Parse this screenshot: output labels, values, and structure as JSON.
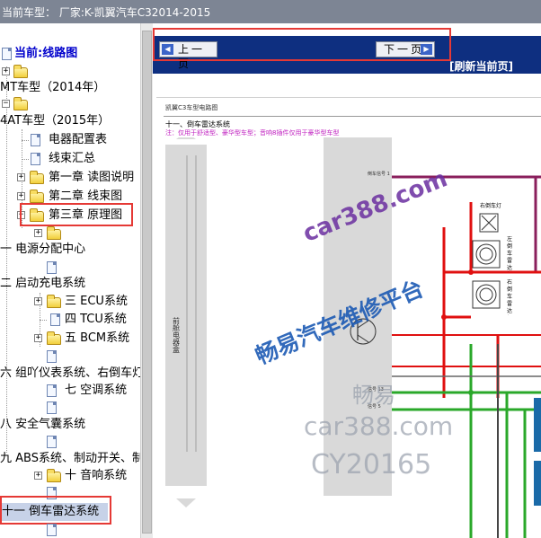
{
  "window": {
    "title": "当前车型：  厂家:K-凯翼汽车C32014-2015"
  },
  "tree": {
    "root": "当前:线路图",
    "items": [
      {
        "label": "MT车型（2014年）"
      },
      {
        "label": "4AT车型（2015年）"
      },
      {
        "label": "电器配置表"
      },
      {
        "label": "线束汇总"
      },
      {
        "label": "第一章 读图说明"
      },
      {
        "label": "第二章 线束图"
      },
      {
        "label": "第三章 原理图"
      },
      {
        "label": "一 电源分配中心"
      },
      {
        "label": "二 启动充电系统"
      },
      {
        "label": "三 ECU系统"
      },
      {
        "label": "四 TCU系统"
      },
      {
        "label": "五 BCM系统"
      },
      {
        "label": "六 组吖仪表系统、右倒车灯"
      },
      {
        "label": "七 空调系统"
      },
      {
        "label": "八 安全气囊系统"
      },
      {
        "label": "九 ABS系统、制动开关、制"
      },
      {
        "label": "十 音响系统"
      },
      {
        "label": "十一 倒车雷达系统"
      }
    ]
  },
  "toolbar": {
    "prev_label": "上一页",
    "next_label": "下一页",
    "refresh_label": "[刷新当前页]"
  },
  "document": {
    "header": "凯翼C3车型电路图",
    "section_title": "十一、倒车雷达系统",
    "note": "注：仅用于舒适型、豪华型车型；音响8插件仅用于豪华型车型",
    "panel_label": "前舱电器盒",
    "labels": {
      "right_reverse_lamp": "右倒车灯",
      "left_sensor": "左倒车雷达探头",
      "right_sensor": "右倒车雷达探头",
      "signal_1": "倒车信号 1",
      "signal_13": "信号 13",
      "signal_5": "信号 5"
    }
  },
  "watermark": {
    "site": "car388.com",
    "platform": "畅易汽车维修平台",
    "brand": "畅易",
    "code": "CY20165"
  },
  "colors": {
    "titlebar": "#7d8594",
    "navbar": "#0e2f80",
    "highlight": "#e53935",
    "watermark": "#1c5ab4",
    "wire_purple": "#8a1f5c",
    "wire_red": "#e01010",
    "wire_green": "#2aa82a"
  }
}
